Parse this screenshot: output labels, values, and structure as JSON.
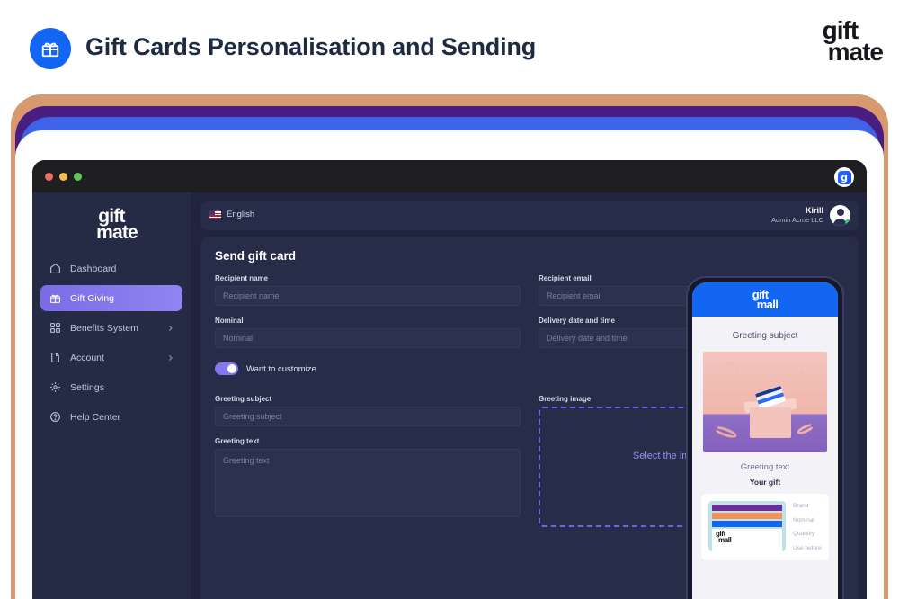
{
  "banner": {
    "title": "Gift Cards Personalisation and Sending",
    "badge_icon": "gift-icon",
    "logo_line1": "gift",
    "logo_line2": "mate"
  },
  "window": {
    "app_icon_letter": "g",
    "traffic_lights": [
      "close",
      "minimize",
      "maximize"
    ]
  },
  "sidebar": {
    "logo_line1": "gift",
    "logo_line2": "mate",
    "items": [
      {
        "label": "Dashboard",
        "icon": "home-icon",
        "active": false,
        "chevron": false
      },
      {
        "label": "Gift Giving",
        "icon": "gift-icon",
        "active": true,
        "chevron": false
      },
      {
        "label": "Benefits System",
        "icon": "grid-icon",
        "active": false,
        "chevron": true
      },
      {
        "label": "Account",
        "icon": "document-icon",
        "active": false,
        "chevron": true
      },
      {
        "label": "Settings",
        "icon": "gear-icon",
        "active": false,
        "chevron": false
      },
      {
        "label": "Help Center",
        "icon": "question-circle-icon",
        "active": false,
        "chevron": false
      }
    ],
    "active_color": "#8378ee"
  },
  "topbar": {
    "language": "English",
    "flag_icon": "us-flag-icon",
    "user_name": "Kirill",
    "user_role": "Admin Acme LLC",
    "avatar_icon": "avatar",
    "status_color": "#2ecc71"
  },
  "main": {
    "title": "Send gift card",
    "fields": {
      "recipient_name": {
        "label": "Recipient name",
        "placeholder": "Recipient name",
        "value": ""
      },
      "recipient_email": {
        "label": "Recipient email",
        "placeholder": "Recipient email",
        "value": ""
      },
      "nominal": {
        "label": "Nominal",
        "placeholder": "Nominal",
        "value": ""
      },
      "delivery": {
        "label": "Delivery date and time",
        "placeholder": "Delivery date and time",
        "value": ""
      },
      "greeting_subject": {
        "label": "Greeting subject",
        "placeholder": "Greeting subject",
        "value": ""
      },
      "greeting_text": {
        "label": "Greeting text",
        "placeholder": "Greeting text",
        "value": ""
      },
      "greeting_image": {
        "label": "Greeting image"
      }
    },
    "customize_toggle": {
      "label": "Want to customize",
      "state": "on"
    },
    "dropzone": {
      "text": "Select the image to upload",
      "icon": "upload-icon",
      "border_color": "#6f63e0"
    }
  },
  "preview": {
    "header_logo_line1": "gift",
    "header_logo_line2": "mall",
    "header_color": "#1266f1",
    "subject": "Greeting subject",
    "greeting_text": "Greeting text",
    "your_gift": "Your gift",
    "card": {
      "logo_line1": "gift",
      "logo_line2": "mall",
      "meta": [
        "Brand",
        "Nominal",
        "Quantity",
        "Use before"
      ]
    }
  }
}
